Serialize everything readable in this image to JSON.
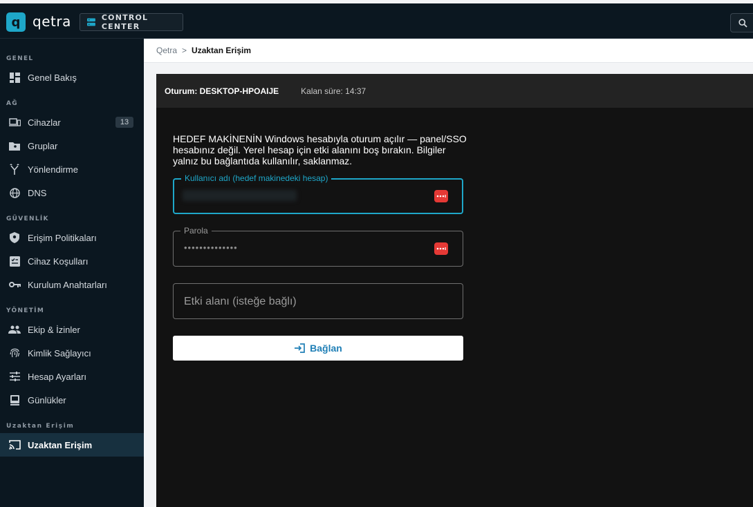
{
  "app": {
    "logo_letter": "q",
    "brand": "qetra",
    "control_center": "CONTROL CENTER"
  },
  "sidebar": {
    "sections": [
      {
        "title": "GENEL",
        "items": [
          {
            "label": "Genel Bakış",
            "icon": "dashboard-icon"
          }
        ]
      },
      {
        "title": "AĞ",
        "items": [
          {
            "label": "Cihazlar",
            "icon": "devices-icon",
            "badge": "13"
          },
          {
            "label": "Gruplar",
            "icon": "folder-icon"
          },
          {
            "label": "Yönlendirme",
            "icon": "routing-icon"
          },
          {
            "label": "DNS",
            "icon": "globe-icon"
          }
        ]
      },
      {
        "title": "GÜVENLİK",
        "items": [
          {
            "label": "Erişim Politikaları",
            "icon": "shield-icon"
          },
          {
            "label": "Cihaz Koşulları",
            "icon": "checklist-icon"
          },
          {
            "label": "Kurulum Anahtarları",
            "icon": "key-icon"
          }
        ]
      },
      {
        "title": "YÖNETİM",
        "items": [
          {
            "label": "Ekip & İzinler",
            "icon": "people-icon"
          },
          {
            "label": "Kimlik Sağlayıcı",
            "icon": "fingerprint-icon"
          },
          {
            "label": "Hesap Ayarları",
            "icon": "sliders-icon"
          },
          {
            "label": "Günlükler",
            "icon": "log-icon"
          }
        ]
      },
      {
        "title": "Uzaktan Erişim",
        "items": [
          {
            "label": "Uzaktan Erişim",
            "icon": "cast-icon",
            "active": true
          }
        ]
      }
    ]
  },
  "breadcrumb": {
    "root": "Qetra",
    "separator": ">",
    "current": "Uzaktan Erişim"
  },
  "session": {
    "name": "Oturum: DESKTOP-HPOAIJE",
    "remaining": "Kalan süre: 14:37"
  },
  "form": {
    "info": "HEDEF MAKİNENİN Windows hesabıyla oturum açılır — panel/SSO hesabınız değil. Yerel hesap için etki alanını boş bırakın. Bilgiler yalnız bu bağlantıda kullanılır, saklanmaz.",
    "username_label": "Kullanıcı adı (hedef makinedeki hesap)",
    "password_label": "Parola",
    "password_value": "••••••••••••••",
    "domain_placeholder": "Etki alanı (isteğe bağlı)",
    "connect_label": "Bağlan"
  },
  "colors": {
    "accent": "#1ea7c9",
    "sidebar_bg": "#0b1720",
    "panel_bg": "#121212",
    "password_manager": "#e53935"
  }
}
